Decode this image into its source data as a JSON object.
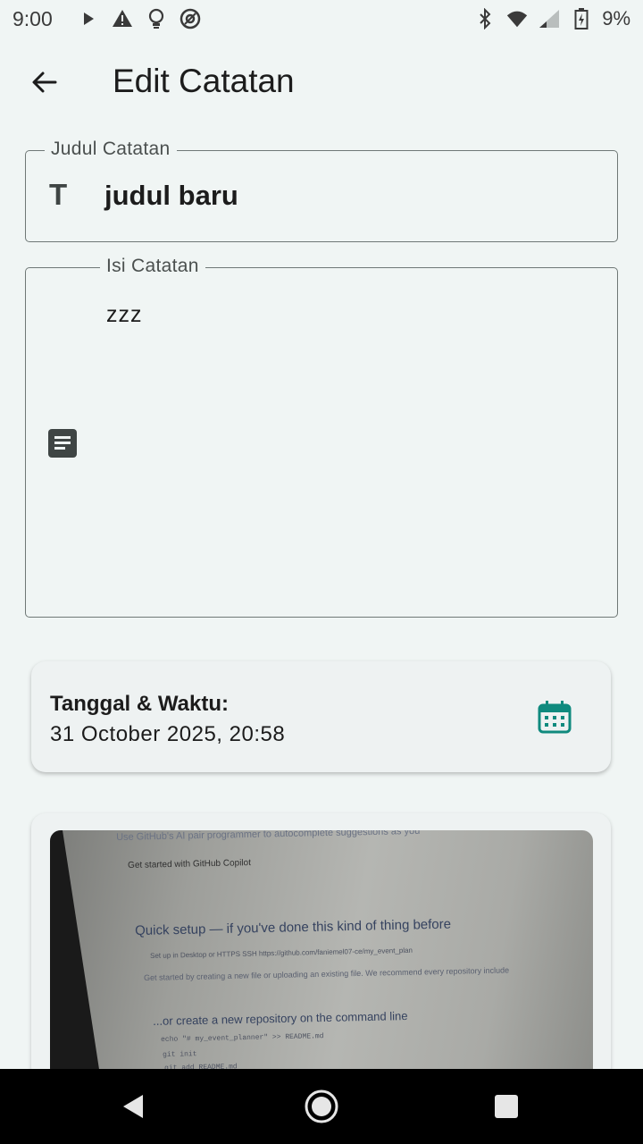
{
  "status_bar": {
    "time": "9:00",
    "battery": "9%",
    "left_icons": [
      "play-icon",
      "warning-icon",
      "lightbulb-icon",
      "at-icon"
    ],
    "right_icons": [
      "bluetooth-icon",
      "wifi-icon",
      "signal-icon",
      "battery-icon"
    ]
  },
  "app_bar": {
    "title": "Edit Catatan",
    "back_icon": "arrow-left-icon"
  },
  "form": {
    "title_field": {
      "label": "Judul Catatan",
      "value": "judul baru",
      "icon": "T"
    },
    "body_field": {
      "label": "Isi Catatan",
      "value": "zzz",
      "icon": "notes-icon"
    }
  },
  "date_card": {
    "label": "Tanggal & Waktu:",
    "value": "31 October 2025, 20:58",
    "icon": "calendar-icon",
    "accent": "#0f8a7e"
  },
  "image_card": {
    "photo_text": {
      "line1": "Use GitHub's AI pair programmer to autocomplete suggestions as you",
      "line2": "Get started with GitHub Copilot",
      "heading1": "Quick setup — if you've done this kind of thing before",
      "setup_row": "Set up in Desktop    or    HTTPS    SSH    https://github.com/faniemel07-ce/my_event_plan",
      "line3": "Get started by creating a new file or uploading an existing file. We recommend every repository include",
      "heading2": "...or create a new repository on the command line",
      "code1": "echo \"# my_event_planner\" >> README.md",
      "code2": "git init",
      "code3": "git add README.md"
    }
  },
  "nav_bar": {
    "icons": [
      "nav-back-icon",
      "nav-home-icon",
      "nav-recents-icon"
    ]
  },
  "colors": {
    "background": "#f0f5f4",
    "accent": "#0f8a7e",
    "outline": "#6f7876"
  }
}
